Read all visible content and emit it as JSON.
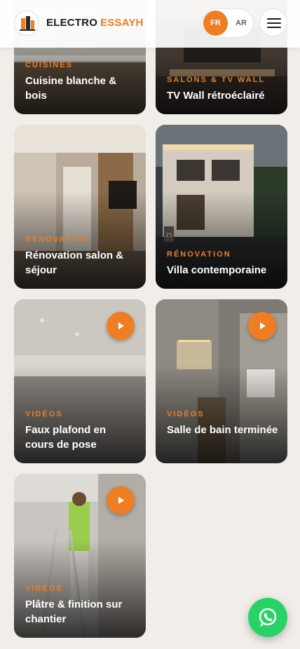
{
  "header": {
    "brand_part1": "ELECTRO",
    "brand_part2": "ESSAYH",
    "lang_active": "FR",
    "lang_other": "AR",
    "menu_icon": "hamburger-icon"
  },
  "colors": {
    "accent": "#ef7d22",
    "whatsapp": "#27d366",
    "background": "#f1ede8"
  },
  "gallery": [
    {
      "category": "CUISINES",
      "title": "Cuisine blanche & bois",
      "video": false
    },
    {
      "category": "SALONS & TV WALL",
      "title": "TV Wall rétroéclairé",
      "video": false
    },
    {
      "category": "RÉNOVATION",
      "title": "Rénovation salon & séjour",
      "video": false
    },
    {
      "category": "RÉNOVATION",
      "title": "Villa contemporaine",
      "video": false,
      "house_number": "25"
    },
    {
      "category": "VIDÉOS",
      "title": "Faux plafond en cours de pose",
      "video": true
    },
    {
      "category": "VIDÉOS",
      "title": "Salle de bain terminée",
      "video": true
    },
    {
      "category": "VIDÉOS",
      "title": "Plâtre & finition sur chantier",
      "video": true
    }
  ],
  "floating": {
    "whatsapp_icon": "whatsapp-icon"
  }
}
